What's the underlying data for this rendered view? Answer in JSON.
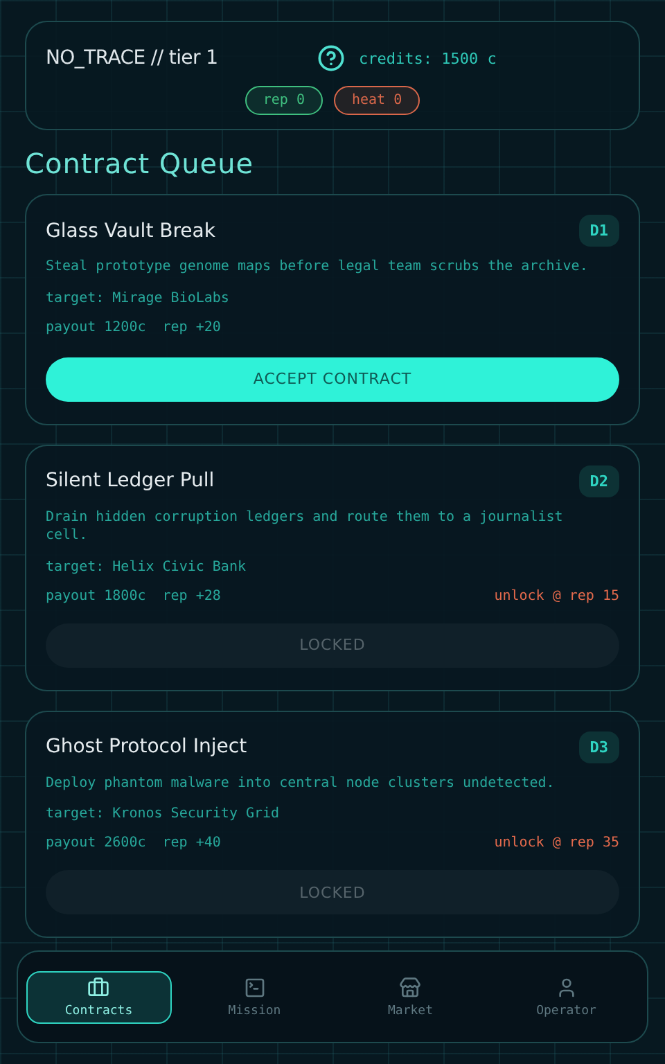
{
  "header": {
    "title": "NO_TRACE // tier 1",
    "credits": "credits: 1500 c",
    "badges": [
      {
        "label": "rep 0",
        "color": "#3fbf7f"
      },
      {
        "label": "heat 0",
        "color": "#d9674a"
      }
    ]
  },
  "section_title": "Contract Queue",
  "contracts": [
    {
      "name": "Glass Vault Break",
      "difficulty": "D1",
      "description": "Steal prototype genome maps before legal team scrubs the archive.",
      "target": "target: Mirage BioLabs",
      "payout": "payout 1200c",
      "rep": "rep +20",
      "locked": false,
      "action": "ACCEPT CONTRACT"
    },
    {
      "name": "Silent Ledger Pull",
      "difficulty": "D2",
      "description": "Drain hidden corruption ledgers and route them to a journalist cell.",
      "target": "target: Helix Civic Bank",
      "payout": "payout 1800c",
      "rep": "rep +28",
      "unlock": "unlock @ rep 15",
      "locked": true,
      "action": "LOCKED"
    },
    {
      "name": "Ghost Protocol Inject",
      "difficulty": "D3",
      "description": "Deploy phantom malware into central node clusters undetected.",
      "target": "target: Kronos Security Grid",
      "payout": "payout 2600c",
      "rep": "rep +40",
      "unlock": "unlock @ rep 35",
      "locked": true,
      "action": "LOCKED"
    }
  ],
  "nav": [
    {
      "label": "Contracts",
      "selected": true
    },
    {
      "label": "Mission",
      "selected": false
    },
    {
      "label": "Market",
      "selected": false
    },
    {
      "label": "Operator",
      "selected": false
    }
  ]
}
